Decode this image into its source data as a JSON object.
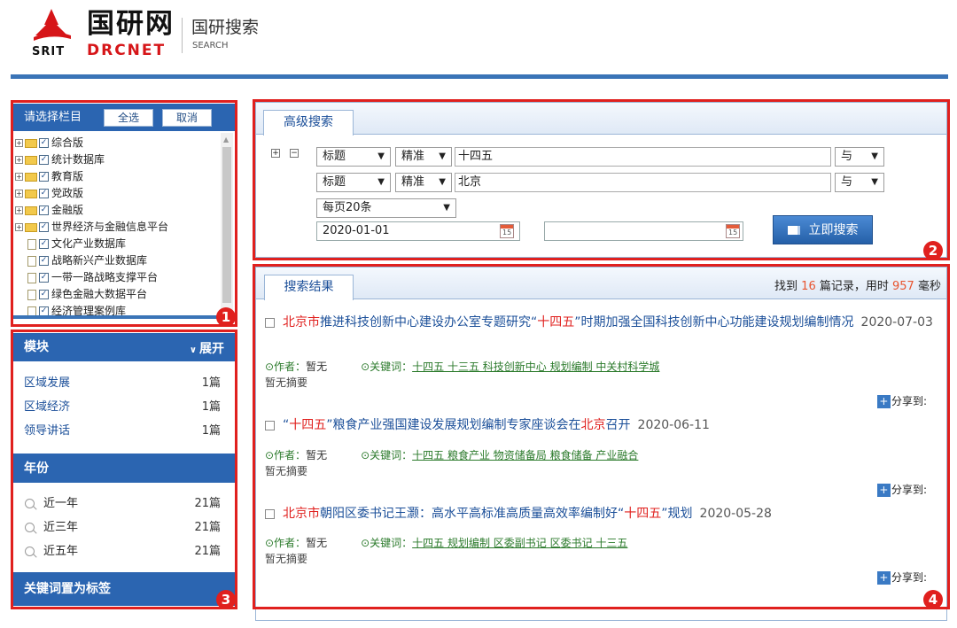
{
  "header": {
    "logo_cn": "国研网",
    "logo_srit": "SRIT",
    "logo_drcnet": "DRCNET",
    "search_name": "国研搜索",
    "search_sub": "SEARCH"
  },
  "category_panel": {
    "title": "请选择栏目",
    "select_all": "全选",
    "cancel": "取消",
    "items": [
      {
        "label": "综合版",
        "type": "folder"
      },
      {
        "label": "统计数据库",
        "type": "folder"
      },
      {
        "label": "教育版",
        "type": "folder"
      },
      {
        "label": "党政版",
        "type": "folder"
      },
      {
        "label": "金融版",
        "type": "folder"
      },
      {
        "label": "世界经济与金融信息平台",
        "type": "folder"
      },
      {
        "label": "文化产业数据库",
        "type": "doc"
      },
      {
        "label": "战略新兴产业数据库",
        "type": "doc"
      },
      {
        "label": "一带一路战略支撑平台",
        "type": "doc"
      },
      {
        "label": "绿色金融大数据平台",
        "type": "doc"
      },
      {
        "label": "经济管理案例库",
        "type": "doc"
      }
    ]
  },
  "facets": {
    "module": {
      "title": "模块",
      "expand": "展开",
      "items": [
        {
          "name": "区域发展",
          "count": "1篇"
        },
        {
          "name": "区域经济",
          "count": "1篇"
        },
        {
          "name": "领导讲话",
          "count": "1篇"
        }
      ]
    },
    "year": {
      "title": "年份",
      "items": [
        {
          "name": "近一年",
          "count": "21篇"
        },
        {
          "name": "近三年",
          "count": "21篇"
        },
        {
          "name": "近五年",
          "count": "21篇"
        }
      ]
    },
    "keyword": {
      "title": "关键词置为标签"
    }
  },
  "advanced": {
    "tab": "高级搜索",
    "plus": "+",
    "minus": "−",
    "row1": {
      "field": "标题",
      "match": "精准",
      "value": "十四五",
      "logic": "与"
    },
    "row2": {
      "field": "标题",
      "match": "精准",
      "value": "北京",
      "logic": "与"
    },
    "per_page": "每页20条",
    "date_from": "2020-01-01",
    "date_to": "",
    "cal_label": "15",
    "button": "立即搜索"
  },
  "results": {
    "tab": "搜索结果",
    "stat_pre": "找到",
    "count": "16",
    "stat_mid": "篇记录，用时",
    "time": "957",
    "stat_post": "毫秒",
    "author_label": "⊙作者：",
    "author": "暂无",
    "kw_label": "⊙关键词：",
    "abstract": "暂无摘要",
    "share": "分享到:",
    "share_icon": "+",
    "items": [
      {
        "title_pre": "",
        "title_red": "北京市",
        "title_post": "推进科技创新中心建设办公室专题研究“",
        "title_red2": "十四五",
        "title_post2": "”时期加强全国科技创新中心功能建设规划编制情况",
        "date": "2020-07-03",
        "keywords": "十四五 十三五 科技创新中心 规划编制 中关村科学城"
      },
      {
        "title_pre": "“",
        "title_red": "十四五",
        "title_post": "”粮食产业强国建设发展规划编制专家座谈会在",
        "title_red2": "北京",
        "title_post2": "召开",
        "date": "2020-06-11",
        "keywords": "十四五 粮食产业 物资储备局 粮食储备 产业融合"
      },
      {
        "title_pre": "",
        "title_red": "北京市",
        "title_post": "朝阳区委书记王灏：高水平高标准高质量高效率编制好“",
        "title_red2": "十四五",
        "title_post2": "”规划",
        "date": "2020-05-28",
        "keywords": "十四五 规划编制 区委副书记 区委书记 十三五"
      }
    ]
  },
  "badges": [
    "1",
    "2",
    "3",
    "4"
  ]
}
